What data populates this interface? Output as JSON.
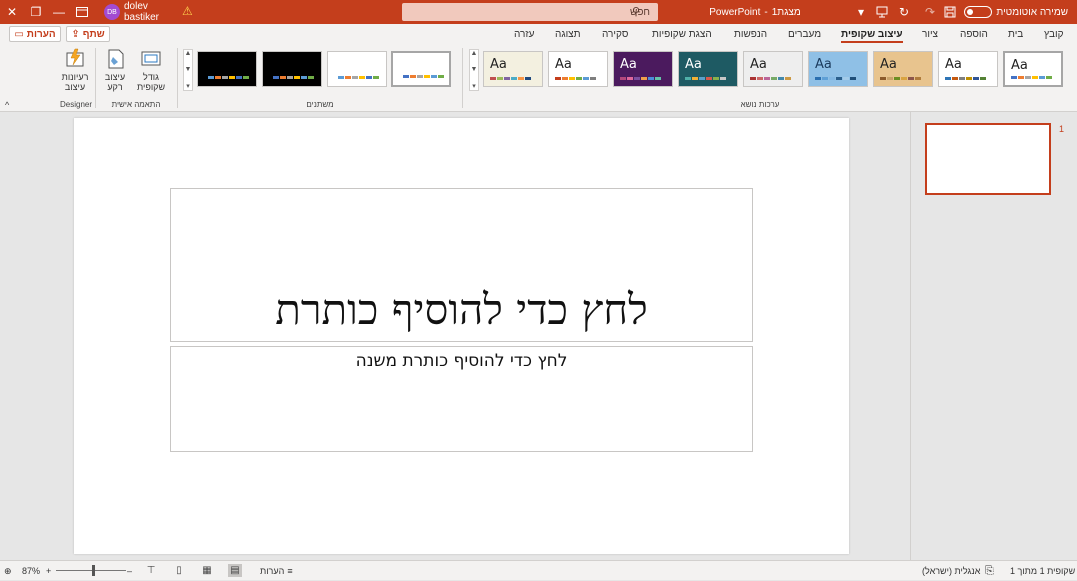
{
  "titlebar": {
    "autosave_label": "שמירה אוטומטית",
    "filename": "מצגת1",
    "app_name": "PowerPoint",
    "search_placeholder": "חפש",
    "user_name": "dolev bastiker",
    "user_initials": "DB",
    "bg_color": "#c43e1c"
  },
  "tabs": [
    {
      "label": "קובץ"
    },
    {
      "label": "בית"
    },
    {
      "label": "הוספה"
    },
    {
      "label": "ציור"
    },
    {
      "label": "עיצוב שקופית",
      "active": true
    },
    {
      "label": "מעברים"
    },
    {
      "label": "הנפשות"
    },
    {
      "label": "הצגת שקופיות"
    },
    {
      "label": "סקירה"
    },
    {
      "label": "תצוגה"
    },
    {
      "label": "עזרה"
    }
  ],
  "top_buttons": {
    "share": "שתף",
    "comments": "הערות"
  },
  "ribbon": {
    "themes_group_label": "ערכות נושא",
    "themes": [
      {
        "aa": "Aa",
        "bg": "#ffffff",
        "fg": "#222222",
        "strip": [
          "#4472c4",
          "#ed7d31",
          "#a5a5a5",
          "#ffc000",
          "#5b9bd5",
          "#70ad47"
        ]
      },
      {
        "aa": "Aa",
        "bg": "#ffffff",
        "fg": "#222222",
        "strip": [
          "#2e75b6",
          "#c55a11",
          "#7f7f7f",
          "#bf9000",
          "#2f5597",
          "#548235"
        ]
      },
      {
        "aa": "Aa",
        "bg": "#e8c48e",
        "fg": "#222222",
        "strip": [
          "#8b5a2b",
          "#c9a36b",
          "#6b8e23",
          "#d9a441",
          "#8c564b",
          "#b07c3b"
        ]
      },
      {
        "aa": "Aa",
        "bg": "#8fc0e6",
        "fg": "#1b3a5c",
        "strip": [
          "#2a6fb0",
          "#5fa0d6",
          "#83b8e3",
          "#2b5f8c",
          "#a3cbe9",
          "#1f4e79"
        ]
      },
      {
        "aa": "Aa",
        "bg": "#eeeeee",
        "fg": "#222222",
        "strip": [
          "#a33",
          "#c66",
          "#b69",
          "#7a6",
          "#48a",
          "#c94"
        ]
      },
      {
        "aa": "Aa",
        "bg": "#1e5a63",
        "fg": "#ffffff",
        "strip": [
          "#4fb0a8",
          "#f2b134",
          "#5aa0c9",
          "#d9584a",
          "#88b04b",
          "#c7c7c7"
        ]
      },
      {
        "aa": "Aa",
        "bg": "#4b1a5e",
        "fg": "#ffffff",
        "strip": [
          "#b4487c",
          "#e0679b",
          "#7a4fa0",
          "#f0a04b",
          "#4b8cd9",
          "#64c3a7"
        ]
      },
      {
        "aa": "Aa",
        "bg": "#ffffff",
        "fg": "#222222",
        "strip": [
          "#c43e1c",
          "#ed7d31",
          "#ffc000",
          "#70ad47",
          "#5b9bd5",
          "#7f7f7f"
        ]
      },
      {
        "aa": "Aa",
        "bg": "#f3f0e0",
        "fg": "#222222",
        "strip": [
          "#c0504d",
          "#9bbb59",
          "#8064a2",
          "#4bacc6",
          "#f79646",
          "#1f497d"
        ]
      }
    ],
    "variants_group_label": "משתנים",
    "variants": [
      {
        "bg": "#ffffff",
        "strip": [
          "#4472c4",
          "#ed7d31",
          "#a5a5a5",
          "#ffc000",
          "#5b9bd5",
          "#70ad47"
        ]
      },
      {
        "bg": "#ffffff",
        "strip": [
          "#5b9bd5",
          "#ed7d31",
          "#a5a5a5",
          "#ffc000",
          "#4472c4",
          "#70ad47"
        ]
      },
      {
        "bg": "#000000",
        "strip": [
          "#4472c4",
          "#ed7d31",
          "#a5a5a5",
          "#ffc000",
          "#5b9bd5",
          "#70ad47"
        ]
      },
      {
        "bg": "#000000",
        "strip": [
          "#5b9bd5",
          "#ed7d31",
          "#a5a5a5",
          "#ffc000",
          "#4472c4",
          "#70ad47"
        ]
      }
    ],
    "customize_group_label": "התאמה אישית",
    "slide_size_label": "גודל\nשקופית",
    "format_bg_label": "עיצוב\nרקע",
    "designer_group_label": "Designer",
    "design_ideas_label": "רעיונות\nעיצוב"
  },
  "slide": {
    "title_placeholder": "לחץ כדי להוסיף כותרת",
    "subtitle_placeholder": "לחץ כדי להוסיף כותרת משנה"
  },
  "thumbnails": {
    "slide_number": "1"
  },
  "statusbar": {
    "slide_info": "שקופית 1 מתוך 1",
    "language": "אנגלית (ישראל)",
    "notes_label": "הערות",
    "zoom": "87%"
  }
}
